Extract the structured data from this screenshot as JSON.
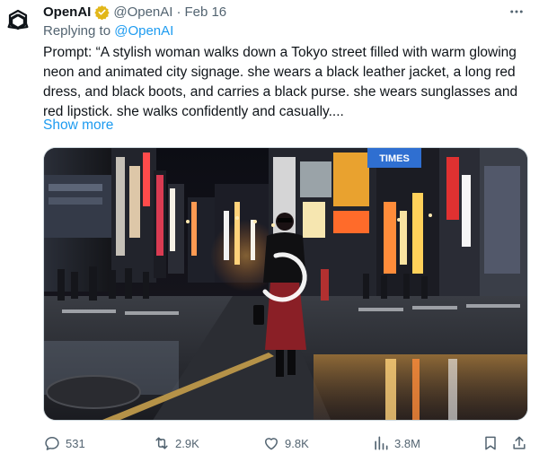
{
  "tweet": {
    "author": {
      "name": "OpenAI",
      "handle": "@OpenAI",
      "separator": "·",
      "date": "Feb 16",
      "verified_color": "#e2b719",
      "avatar_icon": "openai-logo-icon"
    },
    "reply": {
      "prefix": "Replying to ",
      "mention": "@OpenAI"
    },
    "text": "Prompt: “A stylish woman walks down a Tokyo street filled with warm glowing neon and animated city signage. she wears a black leather jacket, a long red dress, and black boots, and carries a black purse. she wears sunglasses and red lipstick. she walks confidently and casually....",
    "show_more": "Show more",
    "media": {
      "overlay_sign": "TIMES",
      "status": "loading"
    },
    "metrics": {
      "replies": "531",
      "reposts": "2.9K",
      "likes": "9.8K",
      "views": "3.8M"
    },
    "colors": {
      "link": "#1d9bf0",
      "secondary_text": "#536471"
    }
  }
}
